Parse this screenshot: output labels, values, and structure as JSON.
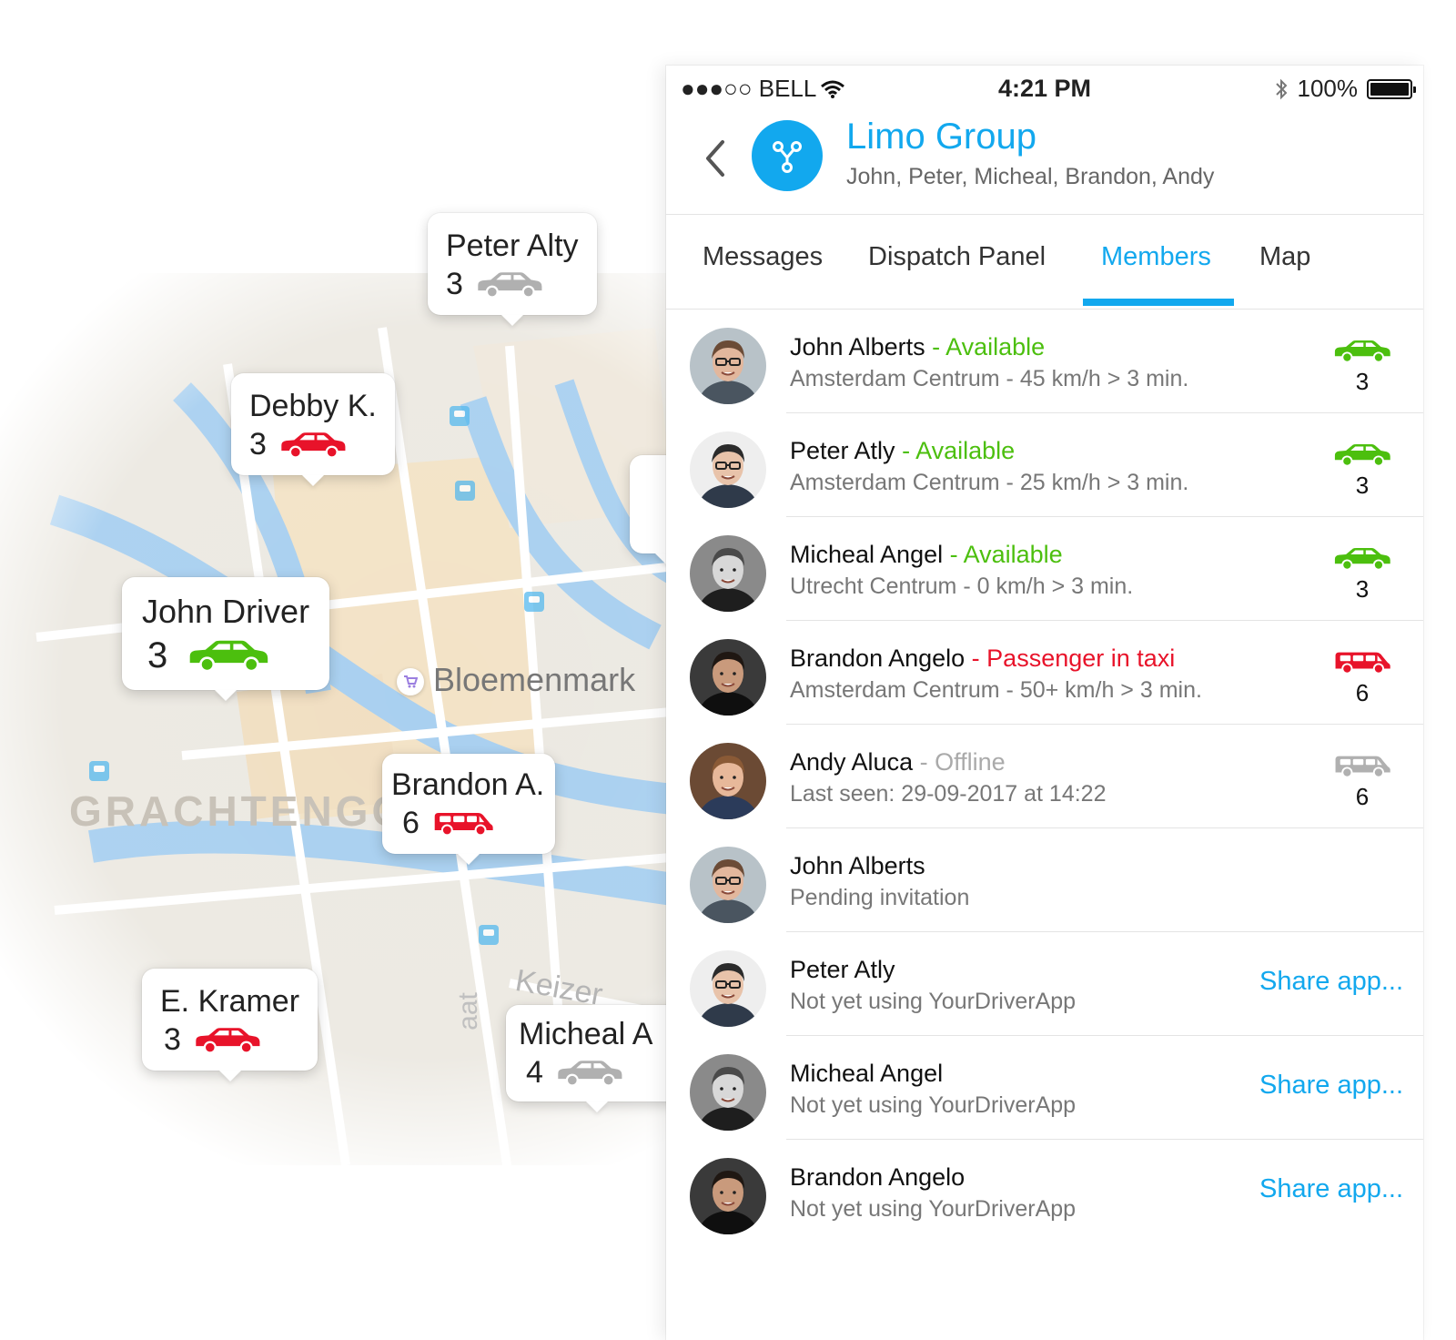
{
  "colors": {
    "accent": "#12a8ee",
    "available": "#4cbf0e",
    "busy": "#e8132a",
    "offline": "#aaaaaa",
    "car_green": "#4cbf0e",
    "car_red": "#e8132a",
    "car_grey": "#b0b0b0"
  },
  "map": {
    "street_label": "Bloemenmark",
    "district_label": "GRACHTENGO",
    "keizer_label": "Keizer",
    "vert_label": "aat",
    "pins": [
      {
        "name": "Peter Alty",
        "count": "3",
        "car": "grey",
        "size": "normal"
      },
      {
        "name": "Debby K.",
        "count": "3",
        "car": "red",
        "size": "normal"
      },
      {
        "name": "John Driver",
        "count": "3",
        "car": "green",
        "size": "big"
      },
      {
        "name": "Brandon A.",
        "count": "6",
        "car": "red-van",
        "size": "normal"
      },
      {
        "name": "E. Kramer",
        "count": "3",
        "car": "red",
        "size": "normal"
      },
      {
        "name": "Micheal A",
        "count": "4",
        "car": "grey",
        "size": "normal"
      }
    ]
  },
  "status_bar": {
    "carrier": "●●●○○ BELL",
    "time": "4:21 PM",
    "battery": "100%"
  },
  "header": {
    "title": "Limo Group",
    "subtitle": "John, Peter, Micheal, Brandon, Andy"
  },
  "tabs": [
    {
      "label": "Messages",
      "active": false
    },
    {
      "label": "Dispatch Panel",
      "active": false
    },
    {
      "label": "Members",
      "active": true
    },
    {
      "label": "Map",
      "active": false
    }
  ],
  "members": [
    {
      "name": "John Alberts",
      "status": " - Available",
      "status_type": "available",
      "detail": "Amsterdam Centrum - 45 km/h > 3 min.",
      "car": "green",
      "count": "3",
      "action": ""
    },
    {
      "name": "Peter Atly",
      "status": " - Available",
      "status_type": "available",
      "detail": "Amsterdam Centrum - 25 km/h > 3 min.",
      "car": "green",
      "count": "3",
      "action": ""
    },
    {
      "name": "Micheal Angel",
      "status": " - Available",
      "status_type": "available",
      "detail": "Utrecht Centrum - 0 km/h > 3 min.",
      "car": "green",
      "count": "3",
      "action": ""
    },
    {
      "name": "Brandon Angelo",
      "status": " - Passenger in taxi",
      "status_type": "busy",
      "detail": "Amsterdam Centrum - 50+ km/h > 3 min.",
      "car": "red-van",
      "count": "6",
      "action": ""
    },
    {
      "name": "Andy Aluca",
      "status": " - Offline",
      "status_type": "offline",
      "detail": "Last seen: 29-09-2017 at 14:22",
      "car": "grey-van",
      "count": "6",
      "action": ""
    },
    {
      "name": "John Alberts",
      "status": "",
      "status_type": "none",
      "detail": "Pending invitation",
      "car": "",
      "count": "",
      "action": ""
    },
    {
      "name": "Peter Atly",
      "status": "",
      "status_type": "none",
      "detail": "Not yet using YourDriverApp",
      "car": "",
      "count": "",
      "action": "Share app..."
    },
    {
      "name": "Micheal Angel",
      "status": "",
      "status_type": "none",
      "detail": "Not yet using YourDriverApp",
      "car": "",
      "count": "",
      "action": "Share app..."
    },
    {
      "name": "Brandon Angelo",
      "status": "",
      "status_type": "none",
      "detail": "Not yet using YourDriverApp",
      "car": "",
      "count": "",
      "action": "Share app..."
    }
  ]
}
